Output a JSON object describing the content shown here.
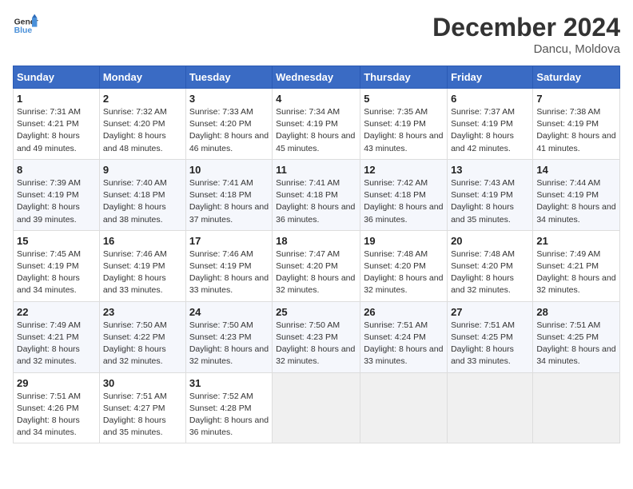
{
  "header": {
    "logo_line1": "General",
    "logo_line2": "Blue",
    "month_title": "December 2024",
    "location": "Dancu, Moldova"
  },
  "weekdays": [
    "Sunday",
    "Monday",
    "Tuesday",
    "Wednesday",
    "Thursday",
    "Friday",
    "Saturday"
  ],
  "weeks": [
    [
      {
        "day": "1",
        "sunrise": "7:31 AM",
        "sunset": "4:21 PM",
        "daylight": "8 hours and 49 minutes."
      },
      {
        "day": "2",
        "sunrise": "7:32 AM",
        "sunset": "4:20 PM",
        "daylight": "8 hours and 48 minutes."
      },
      {
        "day": "3",
        "sunrise": "7:33 AM",
        "sunset": "4:20 PM",
        "daylight": "8 hours and 46 minutes."
      },
      {
        "day": "4",
        "sunrise": "7:34 AM",
        "sunset": "4:19 PM",
        "daylight": "8 hours and 45 minutes."
      },
      {
        "day": "5",
        "sunrise": "7:35 AM",
        "sunset": "4:19 PM",
        "daylight": "8 hours and 43 minutes."
      },
      {
        "day": "6",
        "sunrise": "7:37 AM",
        "sunset": "4:19 PM",
        "daylight": "8 hours and 42 minutes."
      },
      {
        "day": "7",
        "sunrise": "7:38 AM",
        "sunset": "4:19 PM",
        "daylight": "8 hours and 41 minutes."
      }
    ],
    [
      {
        "day": "8",
        "sunrise": "7:39 AM",
        "sunset": "4:19 PM",
        "daylight": "8 hours and 39 minutes."
      },
      {
        "day": "9",
        "sunrise": "7:40 AM",
        "sunset": "4:18 PM",
        "daylight": "8 hours and 38 minutes."
      },
      {
        "day": "10",
        "sunrise": "7:41 AM",
        "sunset": "4:18 PM",
        "daylight": "8 hours and 37 minutes."
      },
      {
        "day": "11",
        "sunrise": "7:41 AM",
        "sunset": "4:18 PM",
        "daylight": "8 hours and 36 minutes."
      },
      {
        "day": "12",
        "sunrise": "7:42 AM",
        "sunset": "4:18 PM",
        "daylight": "8 hours and 36 minutes."
      },
      {
        "day": "13",
        "sunrise": "7:43 AM",
        "sunset": "4:19 PM",
        "daylight": "8 hours and 35 minutes."
      },
      {
        "day": "14",
        "sunrise": "7:44 AM",
        "sunset": "4:19 PM",
        "daylight": "8 hours and 34 minutes."
      }
    ],
    [
      {
        "day": "15",
        "sunrise": "7:45 AM",
        "sunset": "4:19 PM",
        "daylight": "8 hours and 34 minutes."
      },
      {
        "day": "16",
        "sunrise": "7:46 AM",
        "sunset": "4:19 PM",
        "daylight": "8 hours and 33 minutes."
      },
      {
        "day": "17",
        "sunrise": "7:46 AM",
        "sunset": "4:19 PM",
        "daylight": "8 hours and 33 minutes."
      },
      {
        "day": "18",
        "sunrise": "7:47 AM",
        "sunset": "4:20 PM",
        "daylight": "8 hours and 32 minutes."
      },
      {
        "day": "19",
        "sunrise": "7:48 AM",
        "sunset": "4:20 PM",
        "daylight": "8 hours and 32 minutes."
      },
      {
        "day": "20",
        "sunrise": "7:48 AM",
        "sunset": "4:20 PM",
        "daylight": "8 hours and 32 minutes."
      },
      {
        "day": "21",
        "sunrise": "7:49 AM",
        "sunset": "4:21 PM",
        "daylight": "8 hours and 32 minutes."
      }
    ],
    [
      {
        "day": "22",
        "sunrise": "7:49 AM",
        "sunset": "4:21 PM",
        "daylight": "8 hours and 32 minutes."
      },
      {
        "day": "23",
        "sunrise": "7:50 AM",
        "sunset": "4:22 PM",
        "daylight": "8 hours and 32 minutes."
      },
      {
        "day": "24",
        "sunrise": "7:50 AM",
        "sunset": "4:23 PM",
        "daylight": "8 hours and 32 minutes."
      },
      {
        "day": "25",
        "sunrise": "7:50 AM",
        "sunset": "4:23 PM",
        "daylight": "8 hours and 32 minutes."
      },
      {
        "day": "26",
        "sunrise": "7:51 AM",
        "sunset": "4:24 PM",
        "daylight": "8 hours and 33 minutes."
      },
      {
        "day": "27",
        "sunrise": "7:51 AM",
        "sunset": "4:25 PM",
        "daylight": "8 hours and 33 minutes."
      },
      {
        "day": "28",
        "sunrise": "7:51 AM",
        "sunset": "4:25 PM",
        "daylight": "8 hours and 34 minutes."
      }
    ],
    [
      {
        "day": "29",
        "sunrise": "7:51 AM",
        "sunset": "4:26 PM",
        "daylight": "8 hours and 34 minutes."
      },
      {
        "day": "30",
        "sunrise": "7:51 AM",
        "sunset": "4:27 PM",
        "daylight": "8 hours and 35 minutes."
      },
      {
        "day": "31",
        "sunrise": "7:52 AM",
        "sunset": "4:28 PM",
        "daylight": "8 hours and 36 minutes."
      },
      null,
      null,
      null,
      null
    ]
  ],
  "labels": {
    "sunrise": "Sunrise:",
    "sunset": "Sunset:",
    "daylight": "Daylight:"
  }
}
